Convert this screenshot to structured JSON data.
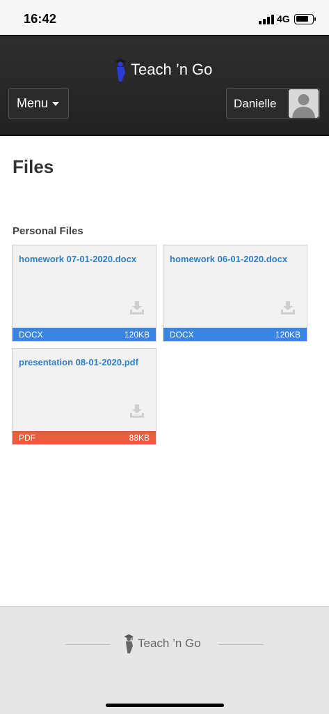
{
  "status_bar": {
    "time": "16:42",
    "network": "4G",
    "battery_level": 0.8,
    "signal_bars": 4
  },
  "header": {
    "brand_name": "Teach ’n Go",
    "menu_label": "Menu",
    "user_name": "Danielle"
  },
  "page": {
    "title": "Files",
    "section_title": "Personal Files"
  },
  "files": [
    {
      "name": "homework 07-01-2020.docx",
      "type": "DOCX",
      "size": "120KB",
      "color": "#3a85e2"
    },
    {
      "name": "homework 06-01-2020.docx",
      "type": "DOCX",
      "size": "120KB",
      "color": "#3a85e2"
    },
    {
      "name": "presentation 08-01-2020.pdf",
      "type": "PDF",
      "size": "88KB",
      "color": "#e85d3e"
    }
  ],
  "footer": {
    "brand_name": "Teach ’n Go"
  },
  "colors": {
    "header_bg": "#272727",
    "link": "#2f7fc5",
    "docx": "#3a85e2",
    "pdf": "#e85d3e"
  }
}
